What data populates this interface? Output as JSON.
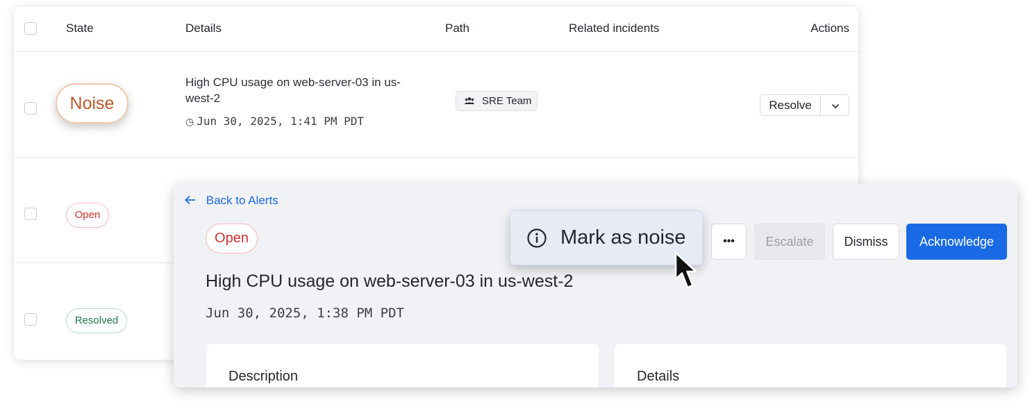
{
  "table": {
    "headers": {
      "state": "State",
      "details": "Details",
      "path": "Path",
      "related_incidents": "Related incidents",
      "actions": "Actions"
    },
    "rows": [
      {
        "state": "Noise",
        "title": "High CPU usage on web-server-03 in us-west-2",
        "time": "Jun 30, 2025, 1:41 PM PDT",
        "path_tag": "SRE Team",
        "action_label": "Resolve"
      },
      {
        "state": "Open"
      },
      {
        "state": "Resolved"
      }
    ]
  },
  "detail": {
    "back_label": "Back to Alerts",
    "state": "Open",
    "title": "High CPU usage on web-server-03 in us-west-2",
    "time": "Jun 30, 2025, 1:38 PM PDT",
    "buttons": {
      "more": "•••",
      "escalate": "Escalate",
      "dismiss": "Dismiss",
      "acknowledge": "Acknowledge"
    },
    "sections": {
      "description": "Description",
      "details": "Details"
    }
  },
  "menu": {
    "mark_as_noise": "Mark as noise"
  },
  "colors": {
    "primary": "#1a6ae6",
    "noise": "#c0572a",
    "open": "#d3322f",
    "resolved": "#1f7a44"
  },
  "icons": [
    "clock-icon",
    "team-icon",
    "chevron-down-icon",
    "arrow-left-icon",
    "info-icon",
    "mouse-cursor"
  ]
}
